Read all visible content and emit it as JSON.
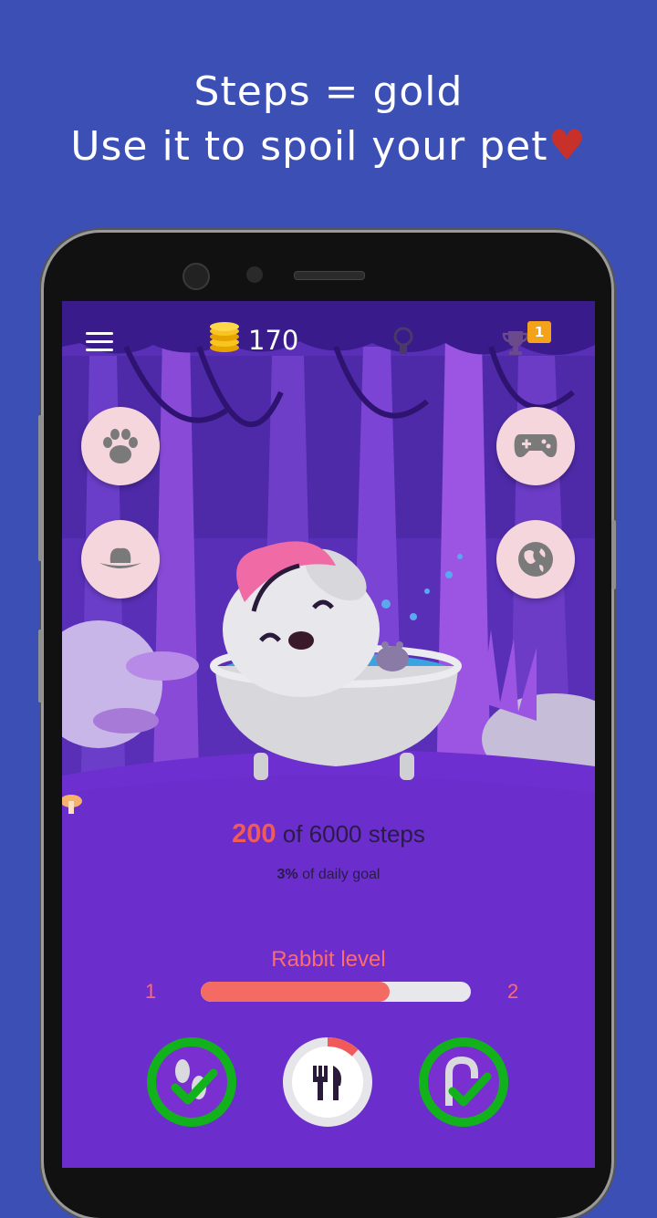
{
  "promo": {
    "line1": "Steps = gold",
    "line2": "Use it to spoil your pet"
  },
  "topbar": {
    "coins": "170",
    "trophy_badge": "1"
  },
  "side_buttons": {
    "left": [
      "paw-icon",
      "hat-icon"
    ],
    "right": [
      "gamepad-icon",
      "globe-icon"
    ]
  },
  "steps": {
    "current": "200",
    "of_text": "of 6000 steps",
    "percent": "3%",
    "goal_text": "of daily goal"
  },
  "level": {
    "title": "Rabbit level",
    "min": "1",
    "max": "2",
    "progress": 0.7
  },
  "bottom_buttons": [
    {
      "icon": "walk-steps-icon",
      "state": "completed"
    },
    {
      "icon": "food-icon",
      "progress": 0.12
    },
    {
      "icon": "shower-icon",
      "state": "completed"
    }
  ],
  "colors": {
    "background": "#3b4fb5",
    "screen": "#7a2fd0",
    "accent": "#f36b63",
    "check_green": "#11b21b",
    "badge": "#f4a21a"
  }
}
